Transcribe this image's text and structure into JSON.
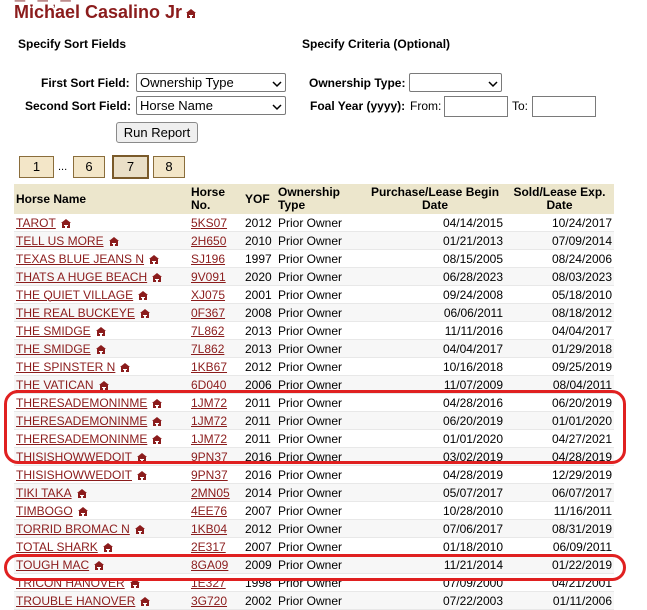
{
  "header": {
    "cutoff_text": "ㅡ ,     ㅡ ,     ㅡ",
    "title": "Michael Casalino Jr"
  },
  "form": {
    "sort_section_label": "Specify Sort Fields",
    "criteria_section_label": "Specify Criteria (Optional)",
    "first_sort_label": "First Sort Field:",
    "first_sort_value": "Ownership Type",
    "second_sort_label": "Second Sort Field:",
    "second_sort_value": "Horse Name",
    "ownership_type_label": "Ownership Type:",
    "ownership_type_value": "",
    "foal_year_label": "Foal Year (yyyy):",
    "from_label": "From:",
    "to_label": "To:",
    "run_report_label": "Run Report"
  },
  "pager": {
    "pages": [
      "1",
      "6",
      "7",
      "8"
    ],
    "ellipsis": "...",
    "current": "7"
  },
  "table": {
    "headers": {
      "horse_name": "Horse Name",
      "horse_no_line1": "Horse",
      "horse_no_line2": "No.",
      "yof": "YOF",
      "ownership_line1": "Ownership",
      "ownership_line2": "Type",
      "purchase_line1": "Purchase/Lease Begin",
      "purchase_line2": "Date",
      "sold_line1": "Sold/Lease Exp.",
      "sold_line2": "Date"
    },
    "rows": [
      {
        "name": "TAROT",
        "no": "5KS07",
        "yof": "2012",
        "type": "Prior Owner",
        "begin": "04/14/2015",
        "end": "10/24/2017"
      },
      {
        "name": "TELL US MORE",
        "no": "2H650",
        "yof": "2010",
        "type": "Prior Owner",
        "begin": "01/21/2013",
        "end": "07/09/2014"
      },
      {
        "name": "TEXAS BLUE JEANS N",
        "no": "SJ196",
        "yof": "1997",
        "type": "Prior Owner",
        "begin": "08/15/2005",
        "end": "08/24/2006"
      },
      {
        "name": "THATS A HUGE BEACH",
        "no": "9V091",
        "yof": "2020",
        "type": "Prior Owner",
        "begin": "06/28/2023",
        "end": "08/03/2023"
      },
      {
        "name": "THE QUIET VILLAGE",
        "no": "XJ075",
        "yof": "2001",
        "type": "Prior Owner",
        "begin": "09/24/2008",
        "end": "05/18/2010"
      },
      {
        "name": "THE REAL BUCKEYE",
        "no": "0F367",
        "yof": "2008",
        "type": "Prior Owner",
        "begin": "06/06/2011",
        "end": "08/18/2012"
      },
      {
        "name": "THE SMIDGE",
        "no": "7L862",
        "yof": "2013",
        "type": "Prior Owner",
        "begin": "11/11/2016",
        "end": "04/04/2017"
      },
      {
        "name": "THE SMIDGE",
        "no": "7L862",
        "yof": "2013",
        "type": "Prior Owner",
        "begin": "04/04/2017",
        "end": "01/29/2018"
      },
      {
        "name": "THE SPINSTER N",
        "no": "1KB67",
        "yof": "2012",
        "type": "Prior Owner",
        "begin": "10/16/2018",
        "end": "09/25/2019"
      },
      {
        "name": "THE VATICAN",
        "no": "6D040",
        "yof": "2006",
        "type": "Prior Owner",
        "begin": "11/07/2009",
        "end": "08/04/2011"
      },
      {
        "name": "THERESADEMONINME",
        "no": "1JM72",
        "yof": "2011",
        "type": "Prior Owner",
        "begin": "04/28/2016",
        "end": "06/20/2019"
      },
      {
        "name": "THERESADEMONINME",
        "no": "1JM72",
        "yof": "2011",
        "type": "Prior Owner",
        "begin": "06/20/2019",
        "end": "01/01/2020"
      },
      {
        "name": "THERESADEMONINME",
        "no": "1JM72",
        "yof": "2011",
        "type": "Prior Owner",
        "begin": "01/01/2020",
        "end": "04/27/2021"
      },
      {
        "name": "THISISHOWWEDOIT",
        "no": "9PN37",
        "yof": "2016",
        "type": "Prior Owner",
        "begin": "03/02/2019",
        "end": "04/28/2019"
      },
      {
        "name": "THISISHOWWEDOIT",
        "no": "9PN37",
        "yof": "2016",
        "type": "Prior Owner",
        "begin": "04/28/2019",
        "end": "12/29/2019"
      },
      {
        "name": "TIKI TAKA",
        "no": "2MN05",
        "yof": "2014",
        "type": "Prior Owner",
        "begin": "05/07/2017",
        "end": "06/07/2017"
      },
      {
        "name": "TIMBOGO",
        "no": "4EE76",
        "yof": "2007",
        "type": "Prior Owner",
        "begin": "10/28/2010",
        "end": "11/16/2011"
      },
      {
        "name": "TORRID BROMAC N",
        "no": "1KB04",
        "yof": "2012",
        "type": "Prior Owner",
        "begin": "07/06/2017",
        "end": "08/31/2019"
      },
      {
        "name": "TOTAL SHARK",
        "no": "2E317",
        "yof": "2007",
        "type": "Prior Owner",
        "begin": "01/18/2010",
        "end": "06/09/2011"
      },
      {
        "name": "TOUGH MAC",
        "no": "8GA09",
        "yof": "2009",
        "type": "Prior Owner",
        "begin": "11/21/2014",
        "end": "01/22/2019"
      },
      {
        "name": "TRICON HANOVER",
        "no": "1E327",
        "yof": "1998",
        "type": "Prior Owner",
        "begin": "07/09/2000",
        "end": "04/21/2001"
      },
      {
        "name": "TROUBLE HANOVER",
        "no": "3G720",
        "yof": "2002",
        "type": "Prior Owner",
        "begin": "07/22/2003",
        "end": "01/11/2006"
      }
    ]
  },
  "colors": {
    "title": "#8b1c1c",
    "link": "#8b1c1c",
    "header_bg": "#ece6cc",
    "annotation": "#e02020"
  }
}
